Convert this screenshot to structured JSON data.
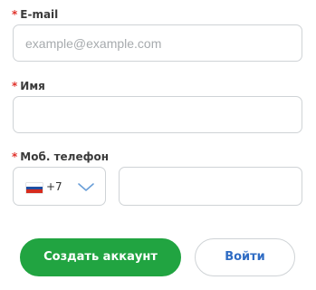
{
  "form": {
    "email": {
      "label": "E-mail",
      "required_mark": "*",
      "placeholder": "example@example.com",
      "value": ""
    },
    "name": {
      "label": "Имя",
      "required_mark": "*",
      "value": ""
    },
    "phone": {
      "label": "Моб. телефон",
      "required_mark": "*",
      "country_code": "+7",
      "country_flag": "russia-flag-icon",
      "value": ""
    },
    "actions": {
      "create_account_label": "Создать аккаунт",
      "login_label": "Войти"
    }
  },
  "colors": {
    "required": "#e0322b",
    "primary_button": "#21a441",
    "link_button_text": "#2f6cc4",
    "field_border": "#cfd3d6"
  }
}
